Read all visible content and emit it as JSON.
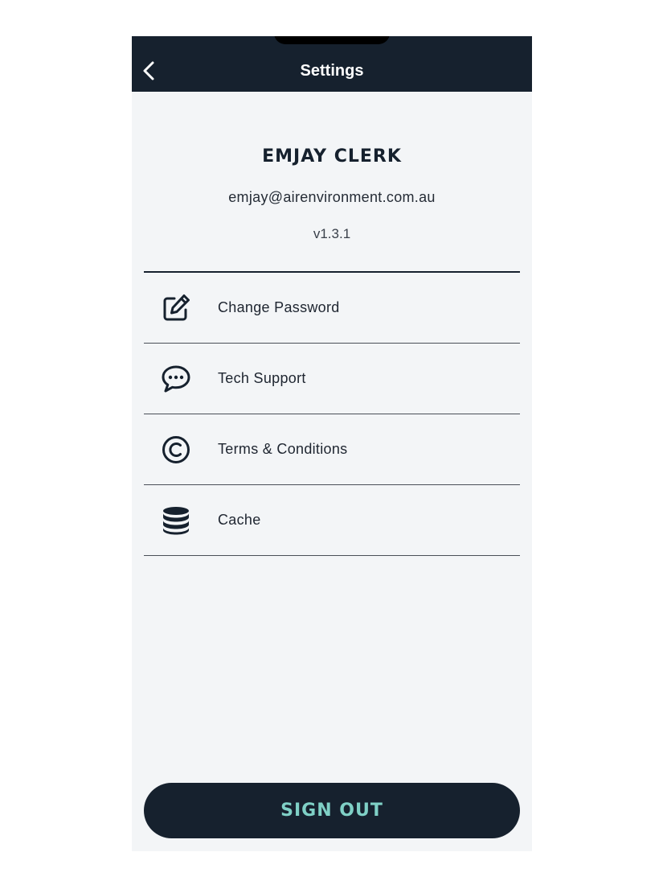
{
  "header": {
    "title": "Settings",
    "back_icon": "chevron-left-icon"
  },
  "profile": {
    "name": "EMJAY CLERK",
    "email": "emjay@airenvironment.com.au",
    "version": "v1.3.1"
  },
  "menu": {
    "items": [
      {
        "label": "Change Password",
        "icon": "edit-icon"
      },
      {
        "label": "Tech Support",
        "icon": "chat-bubble-icon"
      },
      {
        "label": "Terms & Conditions",
        "icon": "copyright-icon"
      },
      {
        "label": "Cache",
        "icon": "database-icon"
      }
    ]
  },
  "actions": {
    "sign_out_label": "SIGN OUT"
  },
  "colors": {
    "primary_dark": "#16212e",
    "background": "#f3f5f7",
    "accent": "#7fd0c6"
  }
}
